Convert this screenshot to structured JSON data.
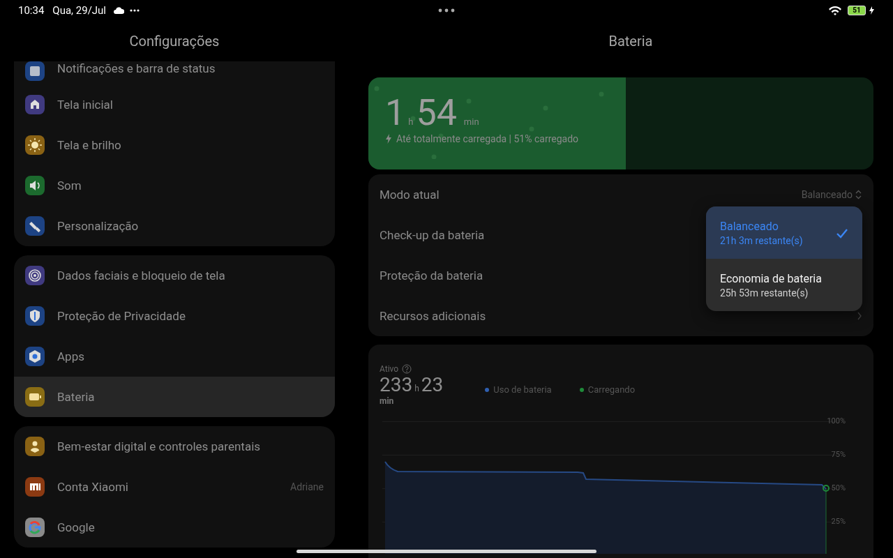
{
  "status_bar": {
    "time": "10:34",
    "date": "Qua, 29/Jul",
    "battery": "51"
  },
  "settings": {
    "title": "Configurações",
    "groups": [
      {
        "items": [
          {
            "label": "Notificações e barra de status",
            "color": "#1d4384",
            "selected": false
          },
          {
            "label": "Tela inicial",
            "color": "#403a80",
            "selected": false
          },
          {
            "label": "Tela e brilho",
            "color": "#8a6214",
            "selected": false
          },
          {
            "label": "Som",
            "color": "#1c6a2e",
            "selected": false
          },
          {
            "label": "Personalização",
            "color": "#1d4384",
            "selected": false
          }
        ]
      },
      {
        "items": [
          {
            "label": "Dados faciais e bloqueio de tela",
            "color": "#403a80",
            "selected": false
          },
          {
            "label": "Proteção de Privacidade",
            "color": "#1d4384",
            "selected": false
          },
          {
            "label": "Apps",
            "color": "#1d4384",
            "selected": false
          },
          {
            "label": "Bateria",
            "color": "#8a6d14",
            "selected": true
          }
        ]
      },
      {
        "items": [
          {
            "label": "Bem-estar digital e controles parentais",
            "color": "#8a6214",
            "selected": false
          },
          {
            "label": "Conta Xiaomi",
            "value": "Adriane",
            "color": "#8c3a12",
            "selected": false
          },
          {
            "label": "Google",
            "color": "#8a8a8a",
            "selected": false
          }
        ]
      }
    ]
  },
  "battery": {
    "title": "Bateria",
    "charge": {
      "level": 0.51,
      "hours": "1",
      "hours_unit": "h",
      "minutes": "54",
      "minutes_unit": "min",
      "status": "Até totalmente carregada | 51% carregado"
    },
    "rows": [
      {
        "kind": "value",
        "label": "Modo atual",
        "value": "Balanceado"
      },
      {
        "kind": "plain",
        "label": "Check-up da bateria"
      },
      {
        "kind": "plain",
        "label": "Proteção da bateria"
      },
      {
        "kind": "link",
        "label": "Recursos adicionais"
      }
    ],
    "mode_menu": [
      {
        "title": "Balanceado",
        "subtitle": "21h 3m restante(s)",
        "selected": true
      },
      {
        "title": "Economia de bateria",
        "subtitle": "25h 53m restante(s)",
        "selected": false
      }
    ],
    "usage": {
      "label": "Ativo",
      "hours": "233",
      "hours_unit": "h",
      "minutes": "23",
      "minutes_unit": "min",
      "legend": [
        {
          "label": "Uso de bateria",
          "color": "#2f5fb0"
        },
        {
          "label": "Carregando",
          "color": "#1f8a3a"
        }
      ],
      "y_labels": [
        "100%",
        "75%",
        "50%",
        "25%"
      ]
    }
  }
}
